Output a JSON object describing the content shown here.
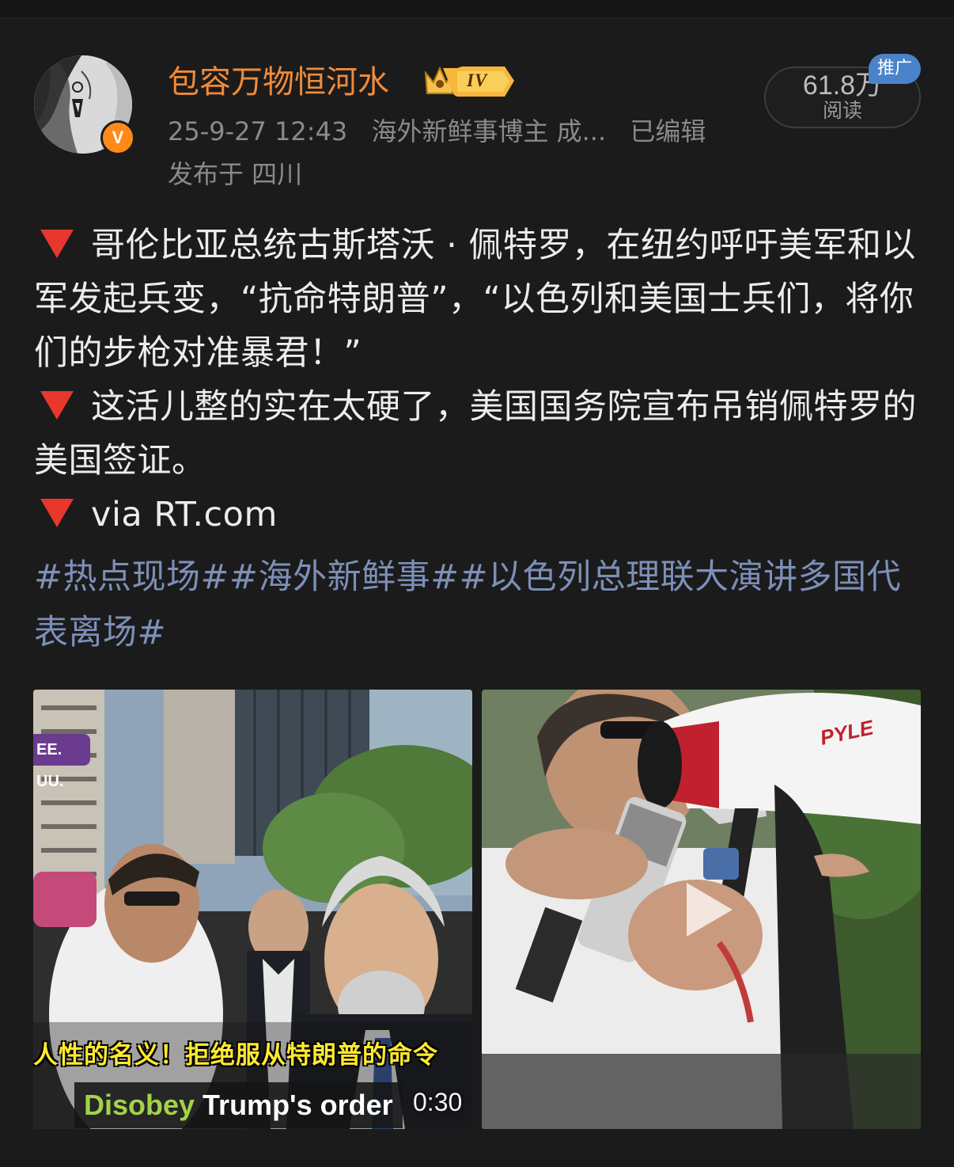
{
  "author": {
    "name": "包容万物恒河水",
    "vip_level": "IV",
    "verified_mark": "V"
  },
  "meta": {
    "time": "25-9-27 12:43",
    "tagline": "海外新鲜事博主 成...",
    "edited": "已编辑",
    "location": "发布于 四川"
  },
  "reads": {
    "count": "61.8万",
    "label": "阅读",
    "promo_tag": "推广"
  },
  "post": {
    "para1": "哥伦比亚总统古斯塔沃 · 佩特罗，在纽约呼吁美军和以军发起兵变，“抗命特朗普”，“以色列和美国士兵们，将你们的步枪对准暴君！”",
    "para2": "这活儿整的实在太硬了，美国国务院宣布吊销佩特罗的美国签证。",
    "para3": "via RT.com",
    "hashtags": "#热点现场##海外新鲜事##以色列总理联大演讲多国代表离场#"
  },
  "media": {
    "left": {
      "corner_tag": "EE. UU.",
      "subtitle_cn": "人性的名义！拒绝服从特朗普的命令",
      "subtitle_en_green": "Disobey",
      "subtitle_en_white": " Trump's order",
      "duration": "0:30"
    },
    "right": {
      "megaphone_brand": "PYLE"
    }
  },
  "colors": {
    "background": "#1b1b1b",
    "username": "#ef8b3a",
    "hashtag": "#7d8fb8",
    "bullet": "#e8372d",
    "promo": "#4a83c9"
  }
}
